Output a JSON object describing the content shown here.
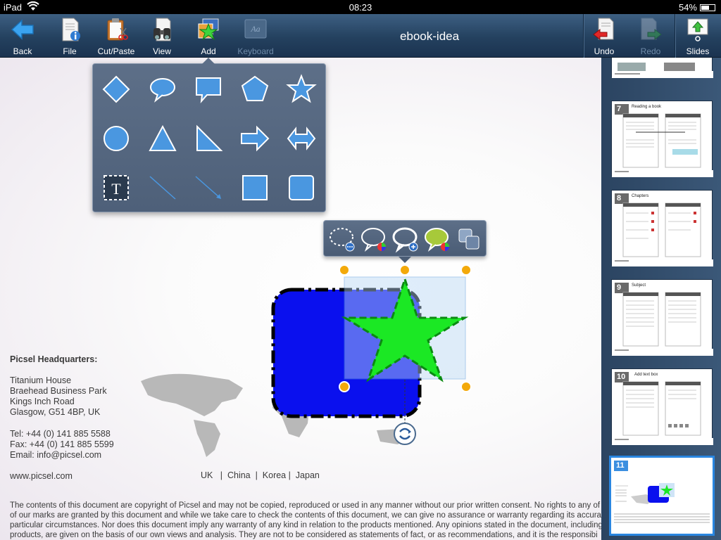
{
  "status_bar": {
    "device": "iPad",
    "time": "08:23",
    "battery": "54%"
  },
  "toolbar": {
    "title": "ebook-idea",
    "back": "Back",
    "file": "File",
    "cut_paste": "Cut/Paste",
    "view": "View",
    "add": "Add",
    "keyboard": "Keyboard",
    "undo": "Undo",
    "redo": "Redo",
    "slides": "Slides"
  },
  "palette": {
    "shapes": [
      "diamond",
      "oval-callout",
      "rect-callout",
      "pentagon",
      "star",
      "circle",
      "triangle",
      "right-triangle",
      "right-arrow",
      "left-right-arrow",
      "text-box",
      "line",
      "arrow-line",
      "square",
      "rounded-square"
    ]
  },
  "context_toolbar": {
    "tools": [
      "outline-style",
      "outline-color",
      "add-fill",
      "fill-color",
      "arrange"
    ]
  },
  "document": {
    "hq_title": "Picsel Headquarters:",
    "address": [
      "Titanium House",
      "Braehead Business Park",
      "Kings Inch Road",
      "Glasgow, G51 4BP, UK"
    ],
    "tel": "Tel: +44 (0) 141 885 5588",
    "fax": "Fax: +44 (0) 141 885 5599",
    "email": "Email: info@picsel.com",
    "website": "www.picsel.com",
    "countries": "UK   |  China  |  Korea |  Japan",
    "legal": [
      "The contents of this document are copyright of Picsel and may not be copied, reproduced or used in any manner without our prior written consent. No rights to any of",
      "of our marks are granted by this document and while we take care to check the contents of this document, we can give no assurance or warranty regarding its accuracy",
      "particular circumstances. Nor does this document imply any warranty of any kind in relation to the products mentioned.  Any opinions stated in the document, including",
      "products, are given on the basis of our own views and analysis. They are not to be considered as statements of fact, or as recommendations, and it is the responsibi"
    ],
    "shape_colors": {
      "rect_fill": "#0a10ee",
      "star_fill": "#1be824",
      "selection": "#b9d8f5",
      "handle": "#f3a90a"
    }
  },
  "slides_panel": {
    "thumbnails": [
      {
        "num": "",
        "title": ""
      },
      {
        "num": "7",
        "title": "Reading a book"
      },
      {
        "num": "8",
        "title": "Chapters"
      },
      {
        "num": "9",
        "title": "Subject"
      },
      {
        "num": "10",
        "title": "Add text box"
      },
      {
        "num": "11",
        "title": "",
        "active": true
      }
    ]
  }
}
